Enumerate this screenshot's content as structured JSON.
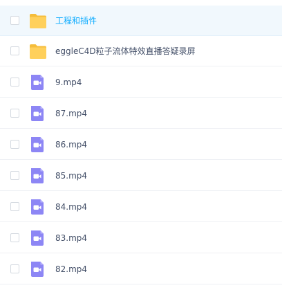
{
  "files": [
    {
      "name": "工程和插件",
      "type": "folder",
      "icon": "folder-icon",
      "highlighted": true
    },
    {
      "name": "eggleC4D粒子流体特效直播答疑录屏",
      "type": "folder",
      "icon": "folder-icon",
      "highlighted": false
    },
    {
      "name": "9.mp4",
      "type": "video",
      "icon": "video-file-icon",
      "highlighted": false
    },
    {
      "name": "87.mp4",
      "type": "video",
      "icon": "video-file-icon",
      "highlighted": false
    },
    {
      "name": "86.mp4",
      "type": "video",
      "icon": "video-file-icon",
      "highlighted": false
    },
    {
      "name": "85.mp4",
      "type": "video",
      "icon": "video-file-icon",
      "highlighted": false
    },
    {
      "name": "84.mp4",
      "type": "video",
      "icon": "video-file-icon",
      "highlighted": false
    },
    {
      "name": "83.mp4",
      "type": "video",
      "icon": "video-file-icon",
      "highlighted": false
    },
    {
      "name": "82.mp4",
      "type": "video",
      "icon": "video-file-icon",
      "highlighted": false
    }
  ],
  "colors": {
    "folder": "#ffd05b",
    "folder_dark": "#f5bd3b",
    "video": "#8d86f5",
    "link": "#09aaff",
    "text": "#424e67"
  }
}
